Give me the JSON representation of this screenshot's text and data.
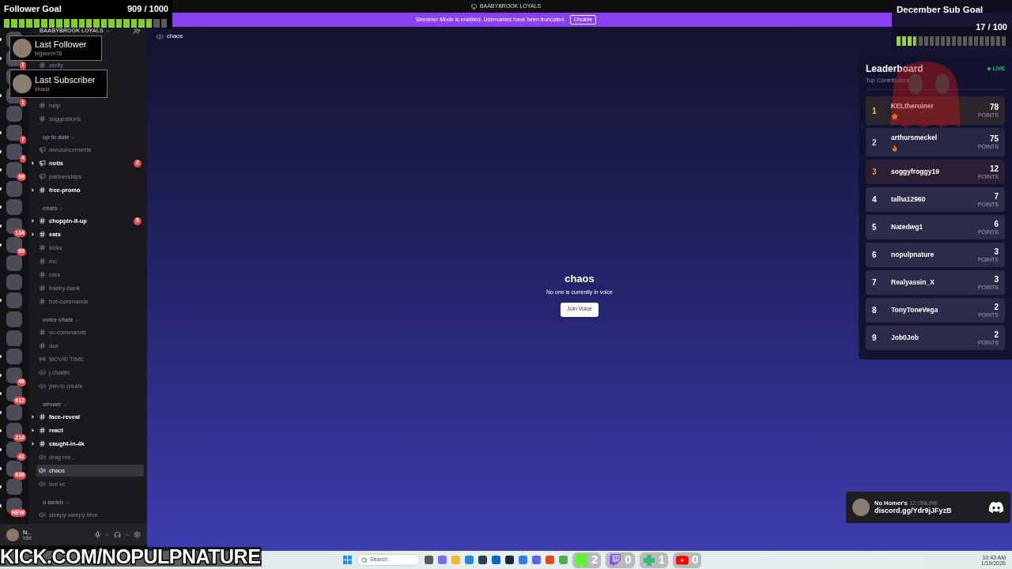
{
  "title_bar": {
    "server_name": "BAABYBROOK LOYALS"
  },
  "banner": {
    "message": "Streamer Mode is enabled. Usernames have been truncated.",
    "button": "Disable"
  },
  "follower_goal": {
    "title": "Follower Goal",
    "count": "909 / 1000",
    "level": 0.909
  },
  "sub_goal": {
    "title": "December Sub Goal",
    "count": "17 / 100",
    "level": 0.17
  },
  "last_follower": {
    "title": "Last Follower",
    "name": "bigworm76"
  },
  "last_subscriber": {
    "title": "Last Subscriber",
    "name": "shodz"
  },
  "servers": [
    {
      "unread": true
    },
    {
      "unread": true,
      "badge": "1"
    },
    {
      "unread": false
    },
    {
      "unread": true,
      "badge": "1"
    },
    {
      "unread": false
    },
    {
      "unread": true,
      "badge": "7"
    },
    {
      "unread": true,
      "badge": "4"
    },
    {
      "unread": true,
      "badge": "99"
    },
    {
      "unread": true
    },
    {
      "unread": true
    },
    {
      "unread": true,
      "badge": "134"
    },
    {
      "unread": true,
      "badge": "69"
    },
    {
      "unread": false
    },
    {
      "unread": false
    },
    {
      "unread": true
    },
    {
      "unread": false
    },
    {
      "unread": false
    },
    {
      "unread": true
    },
    {
      "unread": true,
      "badge": "46"
    },
    {
      "unread": true,
      "badge": "612"
    },
    {
      "unread": true
    },
    {
      "unread": true,
      "badge": "210"
    },
    {
      "unread": true,
      "badge": "41"
    },
    {
      "unread": true,
      "badge": "638"
    },
    {
      "unread": true
    },
    {
      "unread": true,
      "badge": "NEW"
    }
  ],
  "channel_list": {
    "server_name": "BAABYBROOK LOYALS",
    "items": [
      {
        "kind": "text",
        "name": "verify",
        "unread": false,
        "selected": false
      },
      {
        "kind": "gap"
      },
      {
        "kind": "text",
        "name": "help",
        "unread": false,
        "selected": false
      },
      {
        "kind": "text",
        "name": "suggestions",
        "unread": false,
        "selected": false
      },
      {
        "kind": "category",
        "name": "up to date"
      },
      {
        "kind": "announcement",
        "name": "announcements",
        "unread": false,
        "selected": false
      },
      {
        "kind": "announcement",
        "name": "notis",
        "unread": true,
        "selected": false,
        "badge": "2"
      },
      {
        "kind": "announcement",
        "name": "partnerships",
        "unread": false,
        "selected": false
      },
      {
        "kind": "text",
        "name": "free-promo",
        "unread": true,
        "selected": false
      },
      {
        "kind": "category",
        "name": "chats"
      },
      {
        "kind": "text",
        "name": "choppin-it-up",
        "unread": true,
        "selected": false,
        "badge": "5"
      },
      {
        "kind": "text",
        "name": "eats",
        "unread": true,
        "selected": false
      },
      {
        "kind": "text",
        "name": "kicks",
        "unread": false,
        "selected": false
      },
      {
        "kind": "text",
        "name": "mc",
        "unread": false,
        "selected": false
      },
      {
        "kind": "text",
        "name": "cars",
        "unread": false,
        "selected": false
      },
      {
        "kind": "text",
        "name": "baaby-bank",
        "unread": false,
        "selected": false
      },
      {
        "kind": "text",
        "name": "bot-commands",
        "unread": false,
        "selected": false
      },
      {
        "kind": "category",
        "name": "voice chats"
      },
      {
        "kind": "text",
        "name": "vc-commands",
        "unread": false,
        "selected": false
      },
      {
        "kind": "text",
        "name": "aux",
        "unread": false,
        "selected": false
      },
      {
        "kind": "stage",
        "name": "MOVIE TIME",
        "unread": false,
        "selected": false
      },
      {
        "kind": "voice",
        "name": "j chattin",
        "unread": false,
        "selected": false
      },
      {
        "kind": "voice",
        "name": "join to create",
        "unread": false,
        "selected": false
      },
      {
        "kind": "category",
        "name": "stream"
      },
      {
        "kind": "text",
        "name": "face-reveal",
        "unread": true,
        "selected": false
      },
      {
        "kind": "text",
        "name": "react",
        "unread": true,
        "selected": false
      },
      {
        "kind": "text",
        "name": "caught-in-4k",
        "unread": true,
        "selected": false
      },
      {
        "kind": "voice",
        "name": "drag me...",
        "unread": false,
        "selected": false
      },
      {
        "kind": "voice",
        "name": "chaos",
        "unread": false,
        "selected": true
      },
      {
        "kind": "voice",
        "name": "live vc",
        "unread": false,
        "selected": false
      },
      {
        "kind": "category",
        "name": "u lackin"
      },
      {
        "kind": "voice",
        "name": "sleepy weepy time",
        "unread": false,
        "selected": false
      }
    ]
  },
  "user_panel": {
    "name": "N...",
    "status": "Idle"
  },
  "channel_header": {
    "name": "chaos"
  },
  "voice_empty": {
    "title": "chaos",
    "message": "No one is currently in voice",
    "button": "Join Voice"
  },
  "leaderboard": {
    "title": "Leaderboard",
    "subtitle": "Top Contributors",
    "live": "LIVE",
    "entries": [
      {
        "rank": "1",
        "name": "KELtheruiner",
        "kind": "star",
        "points": "78",
        "unit": "POINTS",
        "color": "#facc15"
      },
      {
        "rank": "2",
        "name": "arthursmeckel",
        "kind": "fire",
        "points": "75",
        "unit": "POINTS",
        "color": "#d1d5db"
      },
      {
        "rank": "3",
        "name": "soggyfroggy19",
        "points": "12",
        "unit": "POINTS",
        "color": "#f08a4b"
      },
      {
        "rank": "4",
        "name": "talha12960",
        "points": "7",
        "unit": "POINTS",
        "color": "#ffffff"
      },
      {
        "rank": "5",
        "name": "Natedwg1",
        "points": "6",
        "unit": "POINTS",
        "color": "#ffffff"
      },
      {
        "rank": "6",
        "name": "nopulpnature",
        "points": "3",
        "unit": "POINTS",
        "color": "#ffffff"
      },
      {
        "rank": "7",
        "name": "Realyassin_X",
        "points": "3",
        "unit": "POINTS",
        "color": "#ffffff"
      },
      {
        "rank": "8",
        "name": "TonyToneVega",
        "points": "2",
        "unit": "POINTS",
        "color": "#ffffff"
      },
      {
        "rank": "9",
        "name": "Job0Job",
        "points": "2",
        "unit": "POINTS",
        "color": "#ffffff"
      }
    ]
  },
  "discord_widget": {
    "server": "No Homer's",
    "online": "12 ONLINE",
    "invite": "discord.gg/Ydr9jJFyzB"
  },
  "stream_url": "KICK.COM/NOPULPNATURE",
  "taskbar": {
    "search": "Search",
    "time": "10:43 AM",
    "date": "1/19/2026"
  },
  "viewer_counts": [
    {
      "kind": "kick",
      "count": "2"
    },
    {
      "kind": "twitch",
      "count": "0"
    },
    {
      "kind": "plus",
      "count": "1"
    },
    {
      "kind": "youtube",
      "count": "0"
    }
  ]
}
